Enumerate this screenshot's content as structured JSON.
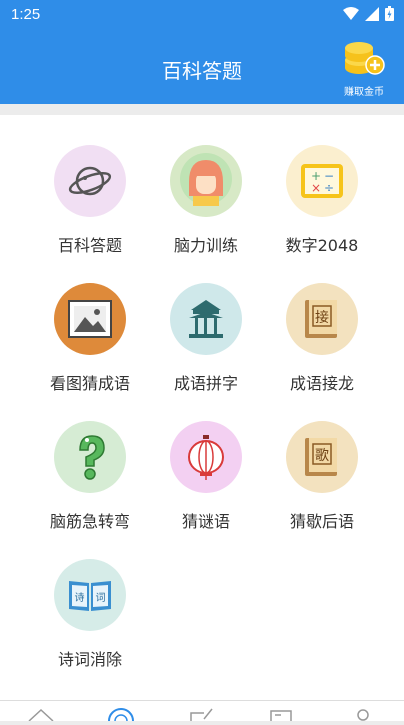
{
  "status": {
    "time": "1:25"
  },
  "header": {
    "title": "百科答题",
    "earn_label": "赚取金币"
  },
  "games": [
    {
      "label": "百科答题",
      "icon": "planet-icon"
    },
    {
      "label": "脑力训练",
      "icon": "girl-icon"
    },
    {
      "label": "数字2048",
      "icon": "math-board-icon"
    },
    {
      "label": "看图猜成语",
      "icon": "picture-icon"
    },
    {
      "label": "成语拼字",
      "icon": "pavilion-icon"
    },
    {
      "label": "成语接龙",
      "icon": "book-jie-icon",
      "glyph": "接"
    },
    {
      "label": "脑筋急转弯",
      "icon": "question-mark-icon"
    },
    {
      "label": "猜谜语",
      "icon": "lantern-icon"
    },
    {
      "label": "猜歇后语",
      "icon": "book-ge-icon",
      "glyph": "歌"
    },
    {
      "label": "诗词消除",
      "icon": "poem-book-icon",
      "glyph_left": "诗",
      "glyph_right": "词"
    }
  ],
  "tabbar": {
    "tabs": [
      {
        "icon": "home-icon"
      },
      {
        "icon": "answer-icon",
        "active": true
      },
      {
        "icon": "edit-icon"
      },
      {
        "icon": "card-icon"
      },
      {
        "icon": "profile-icon"
      }
    ]
  },
  "colors": {
    "primary": "#2f8de8",
    "coin": "#f6c21b"
  }
}
